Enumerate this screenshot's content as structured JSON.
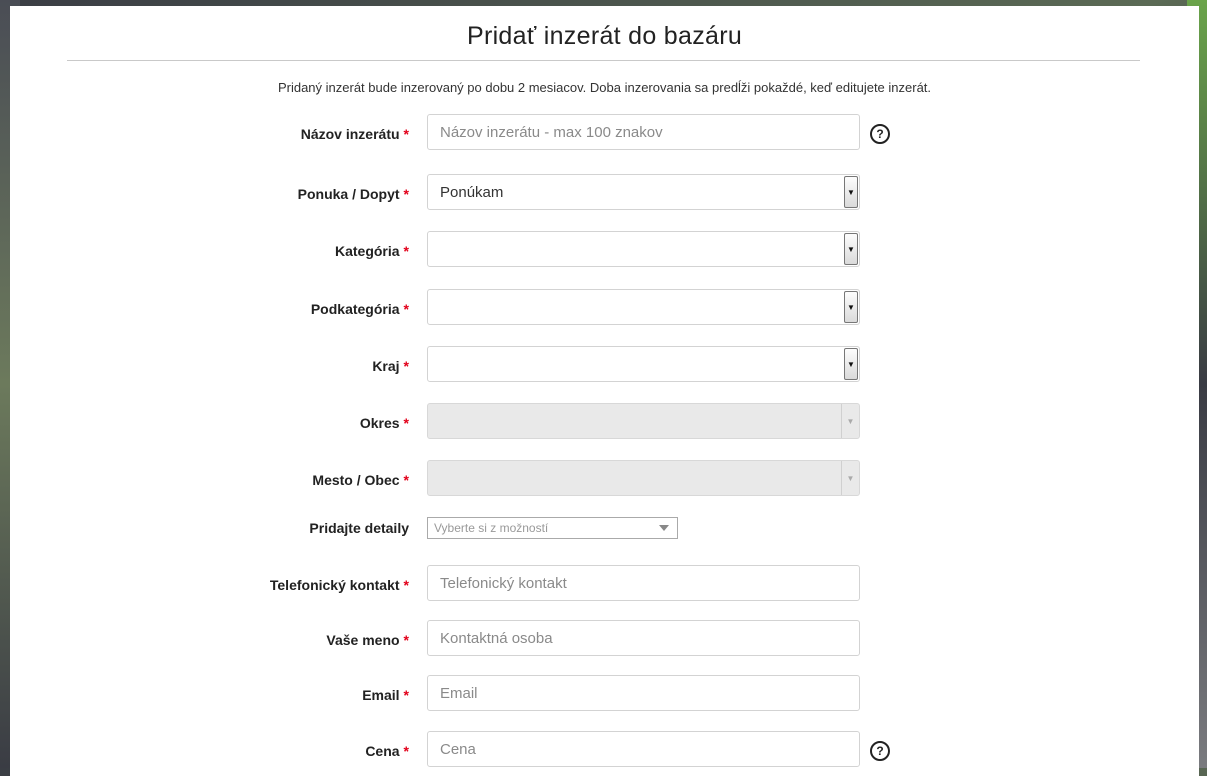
{
  "page": {
    "title": "Pridať inzerát do bazáru",
    "intro": "Pridaný inzerát bude inzerovaný po dobu 2 mesiacov. Doba inzerovania sa predĺži pokaždé, keď editujete inzerát."
  },
  "required_mark": "*",
  "help_glyph": "?",
  "select_arrow_glyph": "▼",
  "form": {
    "nazov": {
      "label": "Názov inzerátu",
      "placeholder": "Názov inzerátu - max 100 znakov"
    },
    "ponuka": {
      "label": "Ponuka / Dopyt",
      "value": "Ponúkam"
    },
    "kategoria": {
      "label": "Kategória",
      "value": ""
    },
    "podkategoria": {
      "label": "Podkategória",
      "value": ""
    },
    "kraj": {
      "label": "Kraj",
      "value": ""
    },
    "okres": {
      "label": "Okres",
      "value": ""
    },
    "mesto": {
      "label": "Mesto / Obec",
      "value": ""
    },
    "detaily": {
      "label": "Pridajte detaily",
      "placeholder": "Vyberte si z možností"
    },
    "telefon": {
      "label": "Telefonický kontakt",
      "placeholder": "Telefonický kontakt"
    },
    "meno": {
      "label": "Vaše meno",
      "placeholder": "Kontaktná osoba"
    },
    "email": {
      "label": "Email",
      "placeholder": "Email"
    },
    "cena": {
      "label": "Cena",
      "placeholder": "Cena"
    }
  },
  "colors": {
    "required": "#e2001a",
    "panel": "#ffffff",
    "disabled": "#e9e9e9"
  }
}
